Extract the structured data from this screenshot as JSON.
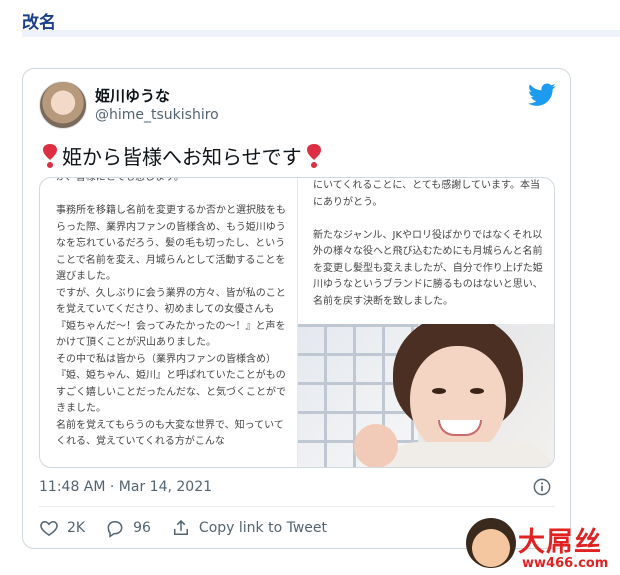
{
  "section": {
    "title": "改名"
  },
  "tweet": {
    "display_name": "姫川ゆうな",
    "username": "@hime_tsukishiro",
    "text": "姫から皆様へお知らせです",
    "timestamp": "11:48 AM · Mar 14, 2021",
    "likes": "2K",
    "replies": "96",
    "copy_link_label": "Copy link to Tweet",
    "brand_color": "#1d9bf0",
    "heart_color": "#dd2e44"
  },
  "media": {
    "left_text": "か、皆様にとても感じます。\n\n事務所を移籍し名前を変更するか否かと選択肢をもらった際、業界内ファンの皆様含め、もう姫川ゆうなを忘れているだろう、髪の毛も切ったし、ということで名前を変え、月城らんとして活動することを選びました。\nですが、久しぶりに会う業界の方々、皆が私のことを覚えていてくださり、初めましての女優さんも『姫ちゃんだ〜！会ってみたかったの〜！』と声をかけて頂くことが沢山ありました。\nその中で私は皆から（業界内ファンの皆様含め）『姫、姫ちゃん、姫川』と呼ばれていたことがものすごく嬉しいことだったんだな、と気づくことができました。\n名前を覚えてもらうのも大変な世界で、知っていてくれる、覚えていてくれる方がこんな",
    "right_text": "にいてくれることに、とても感謝しています。本当にありがとう。\n\n新たなジャンル、JKやロリ役ばかりではなくそれ以外の様々な役へと飛び込むためにも月城らんと名前を変更し髪型も変えましたが、自分で作り上げた姫川ゆうなというブランドに勝るものはないと思い、名前を戻す決断を致しました。"
  },
  "watermark": {
    "brand": "大屌丝",
    "url": "ww466.com"
  },
  "icons": {
    "twitter": "twitter-bird-icon",
    "info": "info-icon",
    "like": "heart-outline-icon",
    "reply": "reply-bubble-icon",
    "share": "share-icon"
  }
}
